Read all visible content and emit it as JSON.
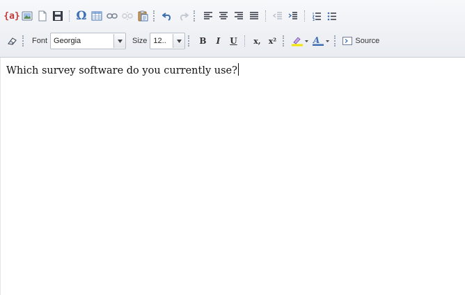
{
  "toolbar": {
    "row1": {
      "merge_fields_label": "{a}",
      "redo_disabled": true
    },
    "row2": {
      "font_label": "Font",
      "font_value": "Georgia",
      "size_label": "Size",
      "size_value": "12..",
      "bold_label": "B",
      "italic_label": "I",
      "underline_label": "U",
      "subscript_label": "x,",
      "superscript_label": "x²",
      "source_label": "Source"
    }
  },
  "editor": {
    "content_text": "Which survey software do you currently use?"
  },
  "colors": {
    "icon_blue": "#3f6fb3",
    "text_highlight": "#f2e600",
    "font_color_accent": "#3f6fb3",
    "merge_red": "#c23b3b"
  }
}
